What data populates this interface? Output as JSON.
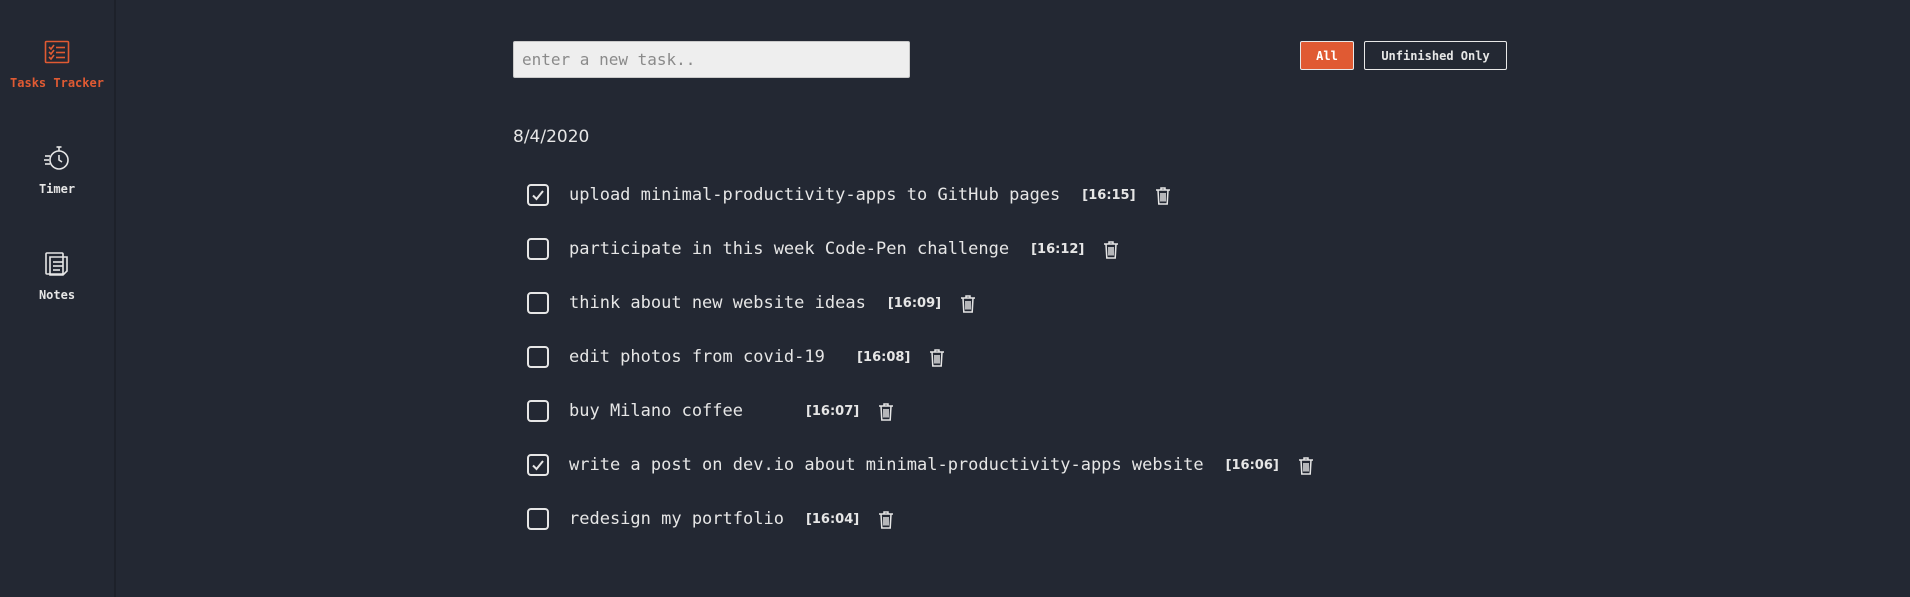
{
  "sidebar": {
    "items": [
      {
        "label": "Tasks Tracker",
        "icon": "checklist-icon",
        "active": true
      },
      {
        "label": "Timer",
        "icon": "stopwatch-icon",
        "active": false
      },
      {
        "label": "Notes",
        "icon": "notes-icon",
        "active": false
      }
    ]
  },
  "task_input": {
    "placeholder": "enter a new task..",
    "value": ""
  },
  "filters": {
    "all_label": "All",
    "unfinished_label": "Unfinished Only",
    "active": "All"
  },
  "colors": {
    "background": "#232833",
    "accent": "#e05a33",
    "text": "#e6e6e6"
  },
  "task_group": {
    "date": "8/4/2020",
    "tasks": [
      {
        "text": "upload minimal-productivity-apps to GitHub pages",
        "time": "[16:15]",
        "done": true
      },
      {
        "text": "participate in this week Code-Pen challenge",
        "time": "[16:12]",
        "done": false
      },
      {
        "text": "think about new website ideas",
        "time": "[16:09]",
        "done": false
      },
      {
        "text": "edit photos from covid-19 ",
        "time": "[16:08]",
        "done": false
      },
      {
        "text": "buy Milano coffee    ",
        "time": "[16:07]",
        "done": false
      },
      {
        "text": "write a post on dev.io about minimal-productivity-apps website",
        "time": "[16:06]",
        "done": true
      },
      {
        "text": "redesign my portfolio",
        "time": "[16:04]",
        "done": false
      }
    ]
  }
}
